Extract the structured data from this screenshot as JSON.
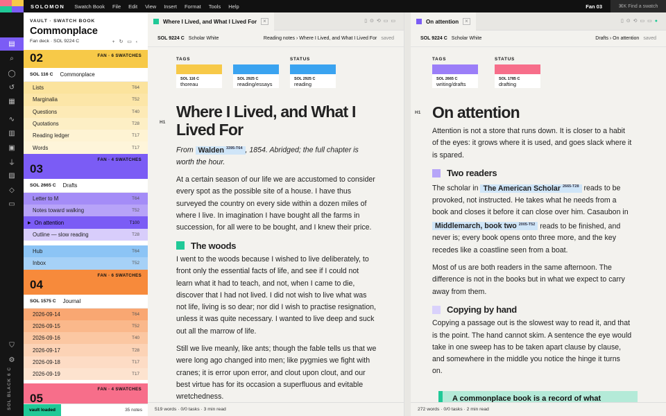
{
  "menubar": {
    "brand": "SOLOMON",
    "items": [
      "Swatch Book",
      "File",
      "Edit",
      "View",
      "Insert",
      "Format",
      "Tools",
      "Help"
    ],
    "fan": "Fan 03",
    "find": "⌘K  Find a swatch"
  },
  "colors": {
    "purple": "#7b5cf5",
    "yellow": "#f7c948",
    "orange": "#f78a3b",
    "pink": "#f76e8a",
    "blue": "#5aa8f0",
    "teal": "#20c997"
  },
  "sidebar": {
    "vault": "VAULT · SWATCH BOOK",
    "title": "Commonplace",
    "deck": "Fan deck · SOL 9224 C",
    "fans": [
      {
        "num": "02",
        "sub": "FAN · 6 SWATCHES",
        "code": "SOL 116 C",
        "name": "Commonplace",
        "items": [
          {
            "l": "Lists",
            "t": "T64"
          },
          {
            "l": "Marginalia",
            "t": "T52"
          },
          {
            "l": "Questions",
            "t": "T40"
          },
          {
            "l": "Quotations",
            "t": "T28"
          },
          {
            "l": "Reading ledger",
            "t": "T17"
          },
          {
            "l": "Words",
            "t": "T17"
          }
        ]
      },
      {
        "num": "03",
        "sub": "FAN · 4 SWATCHES",
        "code": "SOL 2665 C",
        "name": "Drafts",
        "items": [
          {
            "l": "Letter to M",
            "t": "T64"
          },
          {
            "l": "Notes toward walking",
            "t": "T52"
          },
          {
            "l": "On attention",
            "t": "T100"
          },
          {
            "l": "Outline — slow reading",
            "t": "T28"
          }
        ],
        "extra": [
          {
            "l": "Hub",
            "t": "T64"
          },
          {
            "l": "Inbox",
            "t": "T52"
          }
        ]
      },
      {
        "num": "04",
        "sub": "FAN · 6 SWATCHES",
        "code": "SOL 1575 C",
        "name": "Journal",
        "items": [
          {
            "l": "2026-09-14",
            "t": "T64"
          },
          {
            "l": "2026-09-15",
            "t": "T52"
          },
          {
            "l": "2026-09-16",
            "t": "T40"
          },
          {
            "l": "2026-09-17",
            "t": "T28"
          },
          {
            "l": "2026-09-18",
            "t": "T17"
          },
          {
            "l": "2026-09-19",
            "t": "T17"
          }
        ]
      },
      {
        "num": "05",
        "sub": "FAN · 4 SWATCHES"
      }
    ],
    "footer": {
      "status": "vault loaded",
      "count": "35 notes"
    },
    "rail_label": "SOL BLACK 6 C"
  },
  "left": {
    "tab": "Where I Lived, and What I Lived For",
    "code": "SOL 9224 C",
    "sw": "Scholar White",
    "path": "Reading notes  ›  Where I Lived, and What I Lived For",
    "saved": "saved",
    "tags": [
      {
        "h": "TAGS",
        "c": "SOL 116 C",
        "v": "thoreau"
      },
      {
        "h": "",
        "c": "SOL 2925 C",
        "v": "reading/essays"
      },
      {
        "h": "STATUS",
        "c": "SOL 2925 C",
        "v": "reading"
      }
    ],
    "h1": "Where I Lived, and What I Lived For",
    "from_a": "From ",
    "link": "Walden",
    "link_sup": "3395-T64",
    "from_b": ", 1854. Abridged; the full chapter is worth the hour.",
    "p1": "At a certain season of our life we are accustomed to consider every spot as the possible site of a house. I have thus surveyed the country on every side within a dozen miles of where I live. In imagination I have bought all the farms in succession, for all were to be bought, and I knew their price.",
    "h2": "The woods",
    "p2": "I went to the woods because I wished to live deliberately, to front only the essential facts of life, and see if I could not learn what it had to teach, and not, when I came to die, discover that I had not lived. I did not wish to live what was not life, living is so dear; nor did I wish to practise resignation, unless it was quite necessary. I wanted to live deep and suck out all the marrow of life.",
    "p3": "Still we live meanly, like ants; though the fable tells us that we were long ago changed into men; like pygmies we fight with cranes; it is error upon error, and clout upon clout, and our best virtue has for its occasion a superfluous and evitable wretchedness.",
    "footer": "519 words  ·  0/0 tasks  ·  3 min read"
  },
  "right": {
    "tab": "On attention",
    "code": "SOL 9224 C",
    "sw": "Scholar White",
    "path": "Drafts  ›  On attention",
    "saved": "saved",
    "tags": [
      {
        "h": "TAGS",
        "c": "SOL 2665 C",
        "v": "writing/drafts"
      },
      {
        "h": "STATUS",
        "c": "SOL 1785 C",
        "v": "drafting"
      }
    ],
    "h1": "On attention",
    "p1": "Attention is not a store that runs down. It is closer to a habit of the eyes: it grows where it is used, and goes slack where it is spared.",
    "h2a": "Two readers",
    "p2a": "The scholar in ",
    "link1": "The American Scholar",
    "link1_sup": "2665-T28",
    "p2b": " reads to be provoked, not instructed. He takes what he needs from a book and closes it before it can close over him. Casaubon in ",
    "link2": "Middlemarch, book two",
    "link2_sup": "2005-T52",
    "p2c": " reads to be finished, and never is; every book opens onto three more, and the key recedes like a coastline seen from a boat.",
    "p3": "Most of us are both readers in the same afternoon. The difference is not in the books but in what we expect to carry away from them.",
    "h2b": "Copying by hand",
    "p4": "Copying a passage out is the slowest way to read it, and that is the point. The hand cannot skim. A sentence the eye would take in one sweep has to be taken apart clause by clause, and somewhere in the middle you notice the hinge it turns on.",
    "quote": "A commonplace book is a record of what",
    "footer": "272 words  ·  0/0 tasks  ·  2 min read"
  }
}
